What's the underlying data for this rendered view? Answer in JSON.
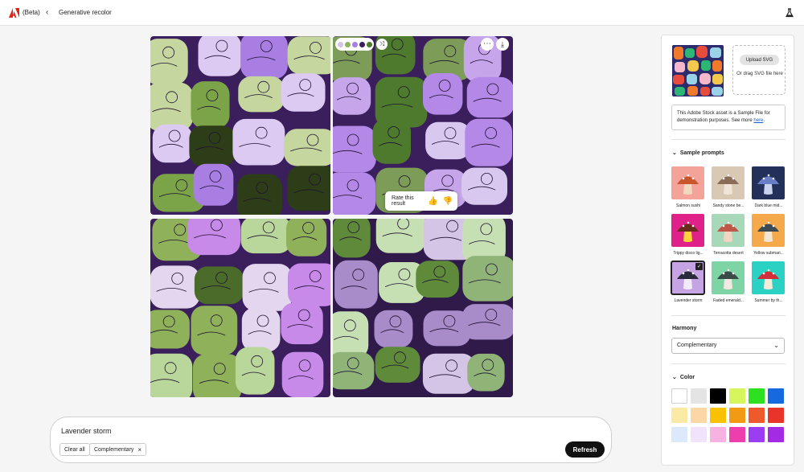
{
  "topbar": {
    "beta": "(Beta)",
    "title": "Generative recolor"
  },
  "tile_palettes": [
    {
      "bg": "#3a1f5c",
      "c1": "#a97ee3",
      "c2": "#c5d69e",
      "c3": "#7ba449",
      "c4": "#2d3d18",
      "c5": "#dccaf2"
    },
    {
      "bg": "#3a1f5c",
      "c1": "#b488e6",
      "c2": "#7c9c58",
      "c3": "#4e7a2e",
      "c4": "#c6a5ea",
      "c5": "#d8c8ef"
    },
    {
      "bg": "#3a1f5c",
      "c1": "#c78ae8",
      "c2": "#8fb15a",
      "c3": "#4a6b29",
      "c4": "#b9d79a",
      "c5": "#e3d6ee"
    },
    {
      "bg": "#2f1a4a",
      "c1": "#a88bc9",
      "c2": "#90b478",
      "c3": "#5e8a3a",
      "c4": "#c7e0b3",
      "c5": "#d4c4e6"
    }
  ],
  "tile_overlay": {
    "palette_dots": [
      "#d4c4e6",
      "#8fb15a",
      "#a97ee3",
      "#3a1f5c",
      "#4e7a2e"
    ],
    "shuffle_icon": "⤨",
    "more_icon": "⋯",
    "download_icon": "⤓"
  },
  "rating": {
    "label": "Rate this result",
    "up": "👍",
    "down": "👎"
  },
  "prompt": {
    "text": "Lavender storm",
    "clear_label": "Clear all",
    "harmony_chip": "Complementary",
    "chip_close": "×",
    "refresh_label": "Refresh"
  },
  "panel": {
    "upload_label": "Upload SVG",
    "upload_hint": "Or drag SVG file here",
    "notice_text": "This Adobe Stock asset is a Sample File for demonstration purposes. See more ",
    "notice_link": "here",
    "notice_end": ".",
    "sample_prompts_title": "Sample prompts",
    "harmony_title": "Harmony",
    "harmony_value": "Complementary",
    "color_title": "Color",
    "chevron": "⌄",
    "caret": "⌄"
  },
  "samples": [
    {
      "label": "Salmon sushi",
      "bg": "#f4a39a",
      "cap": "#c9552d",
      "stem": "#f1d9c0",
      "selected": false
    },
    {
      "label": "Sandy stone be...",
      "bg": "#d9c8b4",
      "cap": "#8a6d58",
      "stem": "#f0e4d8",
      "selected": false
    },
    {
      "label": "Dark blue mid...",
      "bg": "#23305a",
      "cap": "#6a7ec7",
      "stem": "#c9d3ef",
      "selected": false
    },
    {
      "label": "Trippy disco lig...",
      "bg": "#e0218a",
      "cap": "#6a2b1a",
      "stem": "#ffd33a",
      "selected": false
    },
    {
      "label": "Terracotta desert",
      "bg": "#a7d8b8",
      "cap": "#c0584a",
      "stem": "#f3d5c4",
      "selected": false
    },
    {
      "label": "Yellow submari...",
      "bg": "#f5a94a",
      "cap": "#3d4a54",
      "stem": "#f4e6d2",
      "selected": false
    },
    {
      "label": "Lavender storm",
      "bg": "#c6a4e3",
      "cap": "#2b2a3a",
      "stem": "#f2ecf6",
      "selected": true
    },
    {
      "label": "Faded emerald...",
      "bg": "#7fd4a5",
      "cap": "#3a4a47",
      "stem": "#f3e8e2",
      "selected": false
    },
    {
      "label": "Summer by th...",
      "bg": "#2bd2c4",
      "cap": "#d22e3a",
      "stem": "#f6ead8",
      "selected": false
    }
  ],
  "colors": [
    "#ffffff",
    "#e4e4e4",
    "#000000",
    "#d7f55c",
    "#2ee01f",
    "#1769e0",
    "#fbeaa6",
    "#fbd7a8",
    "#f8c200",
    "#f39a15",
    "#ee5a2c",
    "#e8342a",
    "#dce9fa",
    "#f1e3fb",
    "#f8b2e2",
    "#ee3eae",
    "#9b3df2",
    "#a42be4"
  ]
}
